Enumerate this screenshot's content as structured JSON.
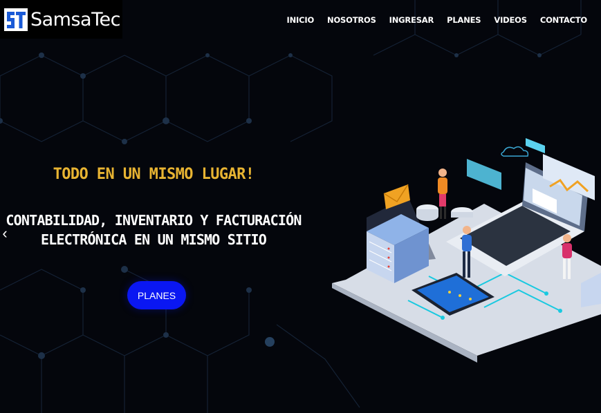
{
  "brand": {
    "name": "SamsaTec",
    "logo_letters": "ST"
  },
  "nav": {
    "items": [
      "INICIO",
      "NOSOTROS",
      "INGRESAR",
      "PLANES",
      "VIDEOS",
      "CONTACTO"
    ]
  },
  "hero": {
    "tagline": "TODO EN UN MISMO LUGAR!",
    "headline_line1": "CONTABILIDAD, INVENTARIO Y FACTURACIÓN",
    "headline_line2": "ELECTRÓNICA EN UN MISMO SITIO",
    "cta_label": "PLANES"
  },
  "colors": {
    "background": "#04060c",
    "accent_gold": "#e8b432",
    "cta_blue": "#0a17f2",
    "network_lines": "#1b2a3c"
  },
  "icons": {
    "prev": "chevron-left-icon"
  }
}
